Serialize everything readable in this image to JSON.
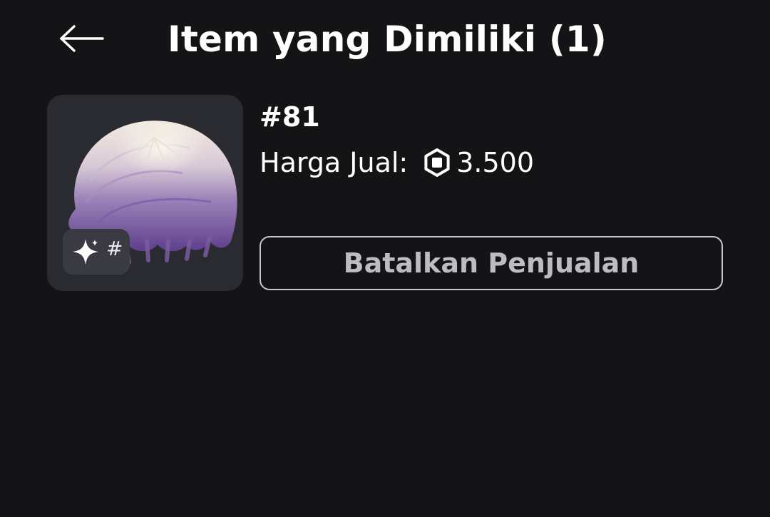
{
  "header": {
    "title": "Item yang Dimiliki (1)",
    "back_icon": "arrow-left-icon"
  },
  "item": {
    "thumbnail_icon": "hair-accessory-image",
    "badge": {
      "icon": "sparkle-icon",
      "text": "#"
    },
    "serial": "#81",
    "price_label": "Harga Jual:",
    "currency_icon": "robux-icon",
    "price_value": "3.500",
    "cancel_label": "Batalkan Penjualan"
  },
  "colors": {
    "background": "#141416",
    "thumbnail_bg": "#2a2b30",
    "badge_bg": "#3a3b42",
    "button_border": "#c8c8cc",
    "button_text": "#bdbdc1",
    "text_primary": "#ffffff"
  }
}
